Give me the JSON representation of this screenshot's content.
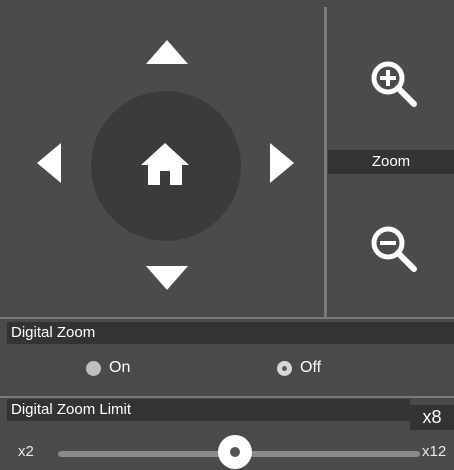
{
  "ptz": {
    "home_icon": "home-icon",
    "arrows": [
      "arrow-up-icon",
      "arrow-down-icon",
      "arrow-left-icon",
      "arrow-right-icon"
    ]
  },
  "zoom": {
    "label": "Zoom",
    "in_icon": "zoom-in-icon",
    "out_icon": "zoom-out-icon"
  },
  "digital_zoom": {
    "title": "Digital Zoom",
    "options": [
      "On",
      "Off"
    ],
    "selected": "Off"
  },
  "digital_zoom_limit": {
    "title": "Digital Zoom Limit",
    "current": "x8",
    "min_label": "x2",
    "max_label": "x12",
    "slider_fraction": 0.55
  },
  "colors": {
    "background": "#4a4a4a",
    "header": "#333333",
    "circle": "#3b3b3b",
    "icon": "#ffffff"
  }
}
